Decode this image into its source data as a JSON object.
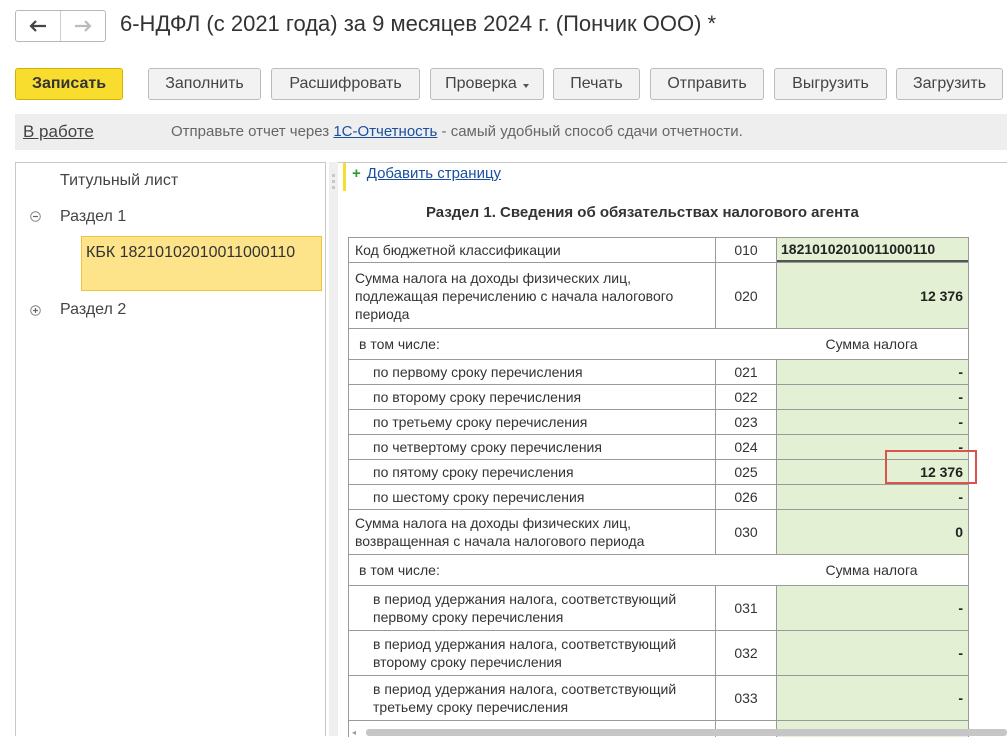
{
  "window": {
    "title": "6-НДФЛ (с 2021 года) за 9 месяцев 2024 г. (Пончик ООО) *"
  },
  "toolbar": {
    "save": "Записать",
    "fill": "Заполнить",
    "decode": "Расшифровать",
    "check": "Проверка",
    "print": "Печать",
    "send": "Отправить",
    "export": "Выгрузить",
    "import": "Загрузить"
  },
  "infobar": {
    "status": "В работе",
    "text_before": "Отправьте отчет через ",
    "link": "1С-Отчетность",
    "text_after": " - самый удобный способ сдачи отчетности."
  },
  "sidebar": {
    "title_page": "Титульный лист",
    "section1": "Раздел 1",
    "kbk_node": "КБК 18210102010011000110",
    "section2": "Раздел 2"
  },
  "form": {
    "add_page": "Добавить страницу",
    "section_title": "Раздел 1. Сведения об обязательствах налогового агента",
    "rows": {
      "r010": {
        "label": "Код бюджетной классификации",
        "code": "010",
        "value": "18210102010011000110"
      },
      "r020": {
        "label": "Сумма налога на доходы физических лиц, подлежащая перечислению с начала налогового периода",
        "code": "020",
        "value": "12 376"
      },
      "sub1": {
        "label": "в том числе:",
        "col": "Сумма налога"
      },
      "r021": {
        "label": "по первому сроку перечисления",
        "code": "021",
        "value": "-"
      },
      "r022": {
        "label": "по второму сроку перечисления",
        "code": "022",
        "value": "-"
      },
      "r023": {
        "label": "по третьему сроку перечисления",
        "code": "023",
        "value": "-"
      },
      "r024": {
        "label": "по четвертому сроку перечисления",
        "code": "024",
        "value": "-"
      },
      "r025": {
        "label": "по пятому сроку перечисления",
        "code": "025",
        "value": "12 376"
      },
      "r026": {
        "label": "по шестому сроку перечисления",
        "code": "026",
        "value": "-"
      },
      "r030": {
        "label": "Сумма налога на доходы физических лиц, возвращенная с начала налогового периода",
        "code": "030",
        "value": "0"
      },
      "sub2": {
        "label": "в том числе:",
        "col": "Сумма налога"
      },
      "r031": {
        "label": "в период удержания налога, соответствующий первому сроку перечисления",
        "code": "031",
        "value": "-"
      },
      "r032": {
        "label": "в период удержания налога, соответствующий второму сроку перечисления",
        "code": "032",
        "value": "-"
      },
      "r033": {
        "label": "в период удержания налога, соответствующий третьему сроку перечисления",
        "code": "033",
        "value": "-"
      }
    }
  },
  "icons": {
    "back": "arrow-left-icon",
    "forward": "arrow-right-icon",
    "collapse": "minus-circle-icon",
    "expand": "plus-circle-icon",
    "add": "plus-icon"
  },
  "colors": {
    "primary_button": "#f8dd2f",
    "selected_node": "#fde38a",
    "input_cell": "#e3f0d3",
    "highlight_frame": "#d9534f",
    "link": "#1a4e9e"
  }
}
